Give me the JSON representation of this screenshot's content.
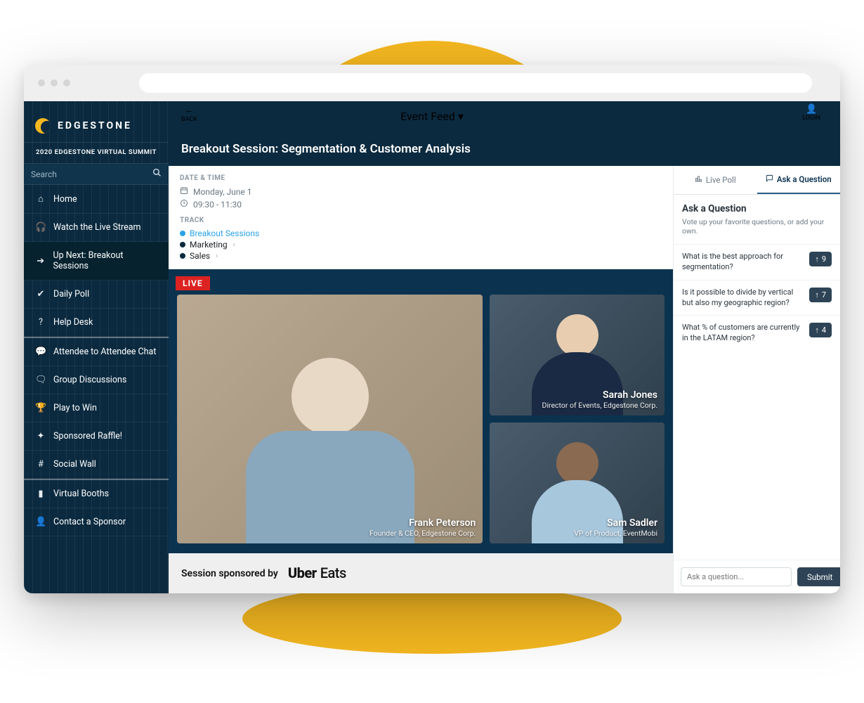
{
  "brand": {
    "name": "EDGESTONE",
    "summit_label": "2020 EDGESTONE VIRTUAL SUMMIT"
  },
  "search": {
    "placeholder": "Search"
  },
  "topbar": {
    "back": "BACK",
    "center": "Event Feed",
    "login": "LOGIN"
  },
  "nav": [
    {
      "icon": "home-icon",
      "glyph": "⌂",
      "label": "Home"
    },
    {
      "icon": "headphones-icon",
      "glyph": "🎧",
      "label": "Watch the Live Stream"
    },
    {
      "icon": "arrow-right-icon",
      "glyph": "➔",
      "label": "Up Next: Breakout Sessions",
      "active": true
    },
    {
      "icon": "check-circle-icon",
      "glyph": "✔",
      "label": "Daily Poll"
    },
    {
      "icon": "question-icon",
      "glyph": "?",
      "label": "Help Desk"
    },
    {
      "icon": "chat-icon",
      "glyph": "💬",
      "label": "Attendee to Attendee Chat",
      "group_top": true
    },
    {
      "icon": "discussion-icon",
      "glyph": "🗨",
      "label": "Group Discussions"
    },
    {
      "icon": "trophy-icon",
      "glyph": "🏆",
      "label": "Play to Win"
    },
    {
      "icon": "wand-icon",
      "glyph": "✦",
      "label": "Sponsored Raffle!"
    },
    {
      "icon": "hash-icon",
      "glyph": "#",
      "label": "Social Wall"
    },
    {
      "icon": "bookmark-icon",
      "glyph": "▮",
      "label": "Virtual Booths",
      "group_top": true
    },
    {
      "icon": "person-icon",
      "glyph": "👤",
      "label": "Contact a Sponsor"
    }
  ],
  "session": {
    "title": "Breakout Session: Segmentation & Customer Analysis",
    "datetime_header": "DATE & TIME",
    "date": "Monday, June 1",
    "time": "09:30 - 11:30",
    "track_header": "TRACK",
    "tracks": [
      {
        "label": "Breakout Sessions",
        "color": "#2aa3e8",
        "link_style": "blue"
      },
      {
        "label": "Marketing",
        "color": "#0b2a3f",
        "chevron": true
      },
      {
        "label": "Sales",
        "color": "#0b2a3f",
        "chevron": true
      }
    ],
    "live_badge": "LIVE",
    "speakers": {
      "main": {
        "name": "Frank Peterson",
        "role": "Founder & CEO, Edgestone Corp."
      },
      "s1": {
        "name": "Sarah Jones",
        "role": "Director of Events, Edgestone Corp."
      },
      "s2": {
        "name": "Sam Sadler",
        "role": "VP of Product, EventMobi"
      }
    },
    "sponsor_prefix": "Session sponsored by",
    "sponsor_logo_main": "Uber",
    "sponsor_logo_sub": "Eats"
  },
  "qa": {
    "tab_poll": "Live Poll",
    "tab_ask": "Ask a Question",
    "heading": "Ask a Question",
    "sub": "Vote up your favorite questions, or add your own.",
    "items": [
      {
        "text": "What is the best approach for segmentation?",
        "votes": 9
      },
      {
        "text": "Is it possible to divide by vertical but also my geographic region?",
        "votes": 7
      },
      {
        "text": "What % of customers are currently in the LATAM region?",
        "votes": 4
      }
    ],
    "input_placeholder": "Ask a question...",
    "submit": "Submit"
  }
}
